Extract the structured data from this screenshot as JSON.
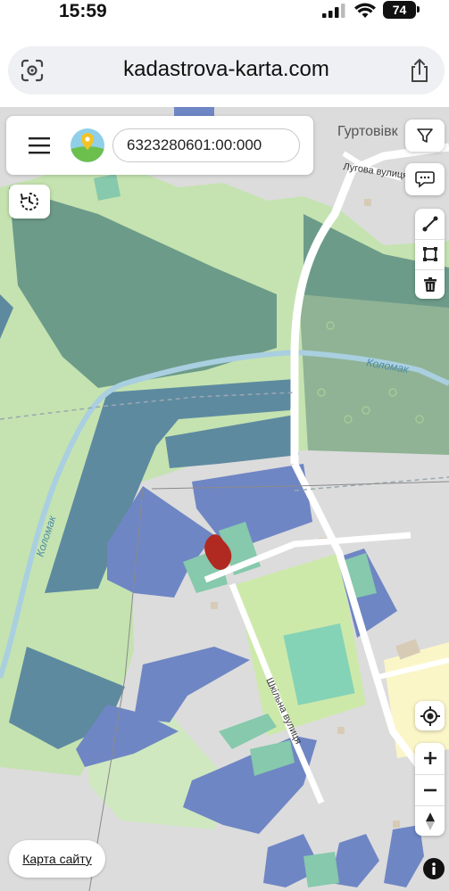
{
  "status": {
    "time": "15:59",
    "battery": "74"
  },
  "browser": {
    "url": "kadastrova-karta.com"
  },
  "search": {
    "value": "6323280601:00:000"
  },
  "map": {
    "labels": {
      "village": "Гуртовівк",
      "street_lugova": "Лугова вулиця",
      "river_1": "Коломак",
      "river_2": "Коломак",
      "street_shkilna": "Шкільна вулиця"
    }
  },
  "footer": {
    "sitemap": "Карта сайту"
  },
  "colors": {
    "meadow": "#c5e3b0",
    "forest": "#6d9b8a",
    "parcel_blue": "#6f86c4",
    "parcel_teal": "#6f9a9a",
    "parcel_green": "#86c9ac",
    "selected": "#b02a22",
    "river": "#a9cfe0"
  },
  "icons": [
    "menu-icon",
    "map-logo-icon",
    "history-icon",
    "filter-icon",
    "comment-icon",
    "line-tool-icon",
    "polygon-tool-icon",
    "trash-icon",
    "locate-icon",
    "zoom-in-icon",
    "zoom-out-icon",
    "compass-icon",
    "info-icon"
  ]
}
